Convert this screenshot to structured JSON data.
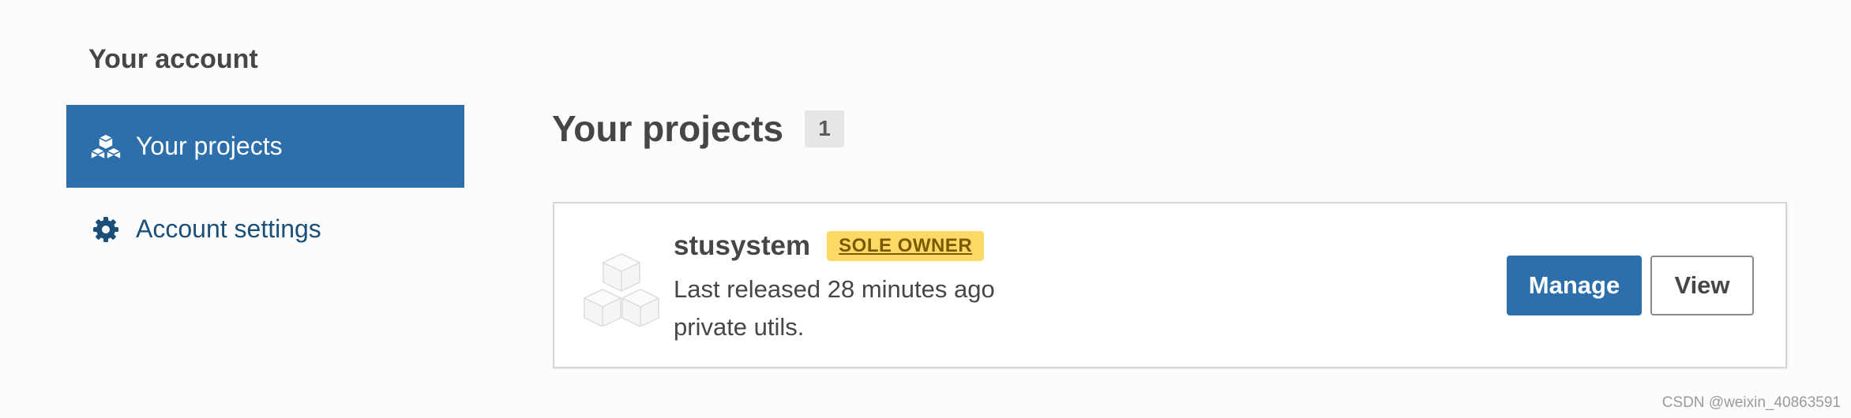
{
  "sidebar": {
    "title": "Your account",
    "items": [
      {
        "label": "Your projects",
        "icon": "cubes-icon",
        "active": true
      },
      {
        "label": "Account settings",
        "icon": "gear-icon",
        "active": false
      }
    ]
  },
  "main": {
    "title": "Your projects",
    "count": "1",
    "projects": [
      {
        "name": "stusystem",
        "role_badge": "SOLE OWNER",
        "last_released": "Last released 28 minutes ago",
        "description": "private utils.",
        "manage_label": "Manage",
        "view_label": "View"
      }
    ]
  },
  "watermark": "CSDN @weixin_40863591",
  "colors": {
    "accent": "#2c6fab",
    "badge": "#ffd966",
    "link": "#1a4f7a"
  }
}
